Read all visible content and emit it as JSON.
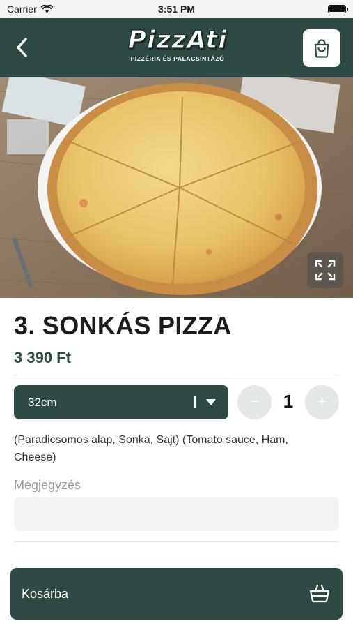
{
  "status_bar": {
    "carrier": "Carrier",
    "time": "3:51 PM"
  },
  "header": {
    "logo_title": "PizzAti",
    "logo_subtitle": "PIZZÉRIA ÉS PALACSINTÁZÓ",
    "back_icon": "chevron-left-icon",
    "cart_icon": "shopping-bag-icon"
  },
  "product": {
    "title": "3. SONKÁS PIZZA",
    "price": "3 390 Ft",
    "size": {
      "selected": "32cm"
    },
    "quantity": "1",
    "minus_label": "−",
    "plus_label": "+",
    "description": "(Paradicsomos alap, Sonka, Sajt) (Tomato sauce, Ham, Cheese)"
  },
  "note": {
    "label": "Megjegyzés",
    "placeholder": "",
    "value": ""
  },
  "add_to_cart": {
    "label": "Kosárba",
    "icon": "basket-icon"
  },
  "colors": {
    "primary": "#2f4a45",
    "qty_button": "#e3e7e8",
    "input_bg": "#f1f3f4"
  }
}
